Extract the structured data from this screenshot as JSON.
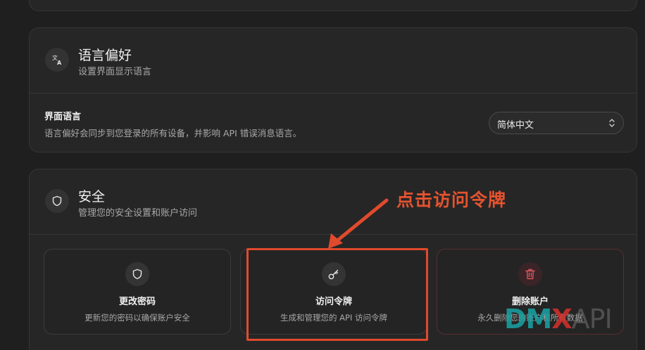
{
  "language": {
    "icon": "translate-icon",
    "title": "语言偏好",
    "subtitle": "设置界面显示语言",
    "row_label": "界面语言",
    "row_desc": "语言偏好会同步到您登录的所有设备，并影响 API 错误消息语言。",
    "selected_language": "简体中文"
  },
  "security": {
    "icon": "shield-icon",
    "title": "安全",
    "subtitle": "管理您的安全设置和账户访问",
    "tiles": [
      {
        "icon": "shield-icon",
        "title": "更改密码",
        "desc": "更新您的密码以确保账户安全"
      },
      {
        "icon": "key-icon",
        "title": "访问令牌",
        "desc": "生成和管理您的 API 访问令牌"
      },
      {
        "icon": "trash-icon",
        "title": "删除账户",
        "desc": "永久删除您的账户和所有数据",
        "color": "#e0555f"
      }
    ]
  },
  "annotation": {
    "text": "点击访问令牌",
    "color": "#e5532f"
  },
  "watermark": {
    "d": "D",
    "m": "M",
    "x": "X",
    "api": "API"
  }
}
